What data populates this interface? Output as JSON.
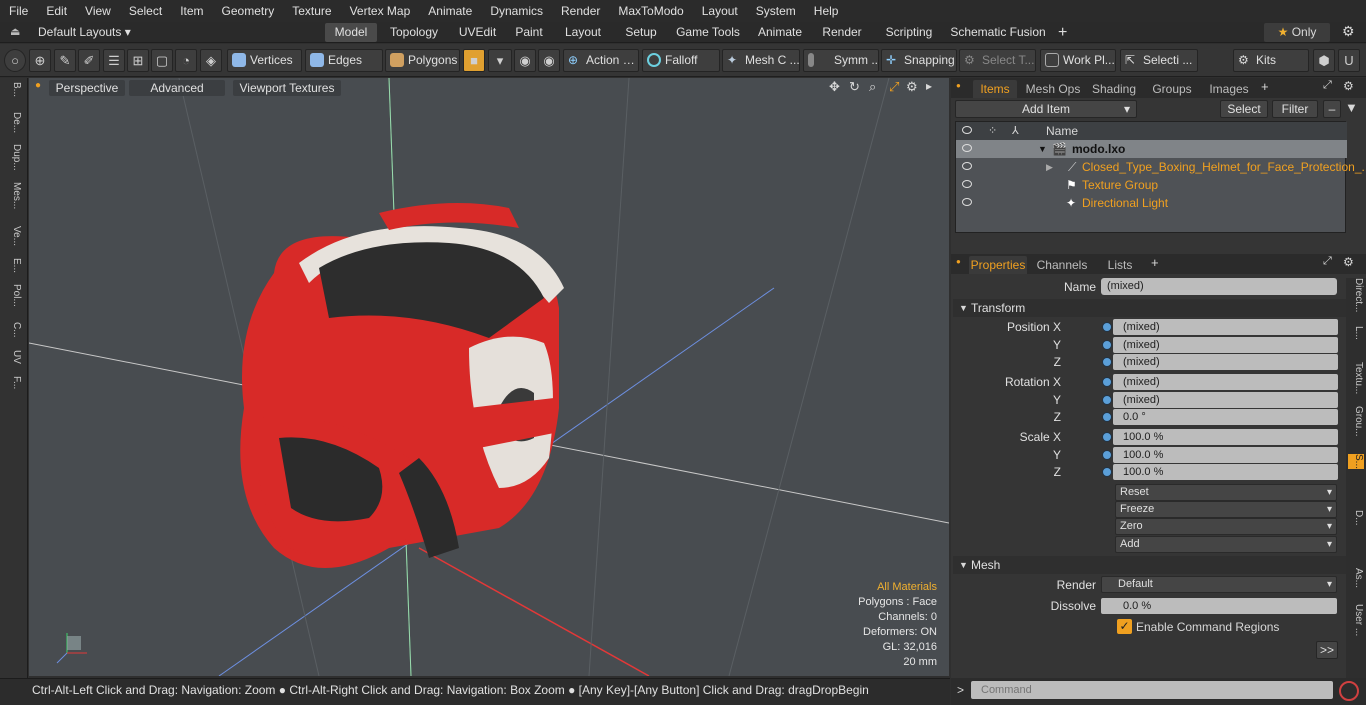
{
  "menu": [
    "File",
    "Edit",
    "View",
    "Select",
    "Item",
    "Geometry",
    "Texture",
    "Vertex Map",
    "Animate",
    "Dynamics",
    "Render",
    "MaxToModo",
    "Layout",
    "System",
    "Help"
  ],
  "layout_switcher": "Default Layouts",
  "mode_tabs": [
    "Model",
    "Topology",
    "UVEdit",
    "Paint",
    "Layout",
    "Setup",
    "Game Tools",
    "Animate",
    "Render",
    "Scripting",
    "Schematic Fusion"
  ],
  "only_label": "Only",
  "toolbar": {
    "vertices": "Vertices",
    "edges": "Edges",
    "polygons": "Polygons",
    "action": "Action",
    "falloff": "Falloff",
    "mesh_c": "Mesh C ...",
    "symm": "Symm ...",
    "snapping": "Snapping",
    "select_t": "Select T...",
    "work_pl": "Work Pl...",
    "selecti": "Selecti ...",
    "kits": "Kits"
  },
  "left_tools": [
    "B...",
    "De...",
    "Dup...",
    "Mes...",
    "Ve...",
    "E...",
    "Pol...",
    "C...",
    "UV",
    "F..."
  ],
  "viewport": {
    "perspective": "Perspective",
    "advanced": "Advanced",
    "viewport_textures": "Viewport Textures",
    "info": {
      "all_materials": "All Materials",
      "polygons": "Polygons : Face",
      "channels": "Channels: 0",
      "deformers": "Deformers: ON",
      "gl": "GL: 32,016",
      "scale": "20 mm"
    }
  },
  "status_text": "Ctrl-Alt-Left Click and Drag: Navigation: Zoom ● Ctrl-Alt-Right Click and Drag: Navigation: Box Zoom ● [Any Key]-[Any Button] Click and Drag: dragDropBegin",
  "items_panel": {
    "tabs": [
      "Items",
      "Mesh Ops",
      "Shading",
      "Groups",
      "Images"
    ],
    "add_item": "Add Item",
    "select": "Select",
    "filter": "Filter",
    "col_name": "Name",
    "rows": [
      "modo.lxo",
      "Closed_Type_Boxing_Helmet_for_Face_Protection_...",
      "Texture Group",
      "Directional Light"
    ]
  },
  "props_panel": {
    "tabs": [
      "Properties",
      "Channels",
      "Lists"
    ],
    "name_label": "Name",
    "name_value": "(mixed)",
    "transform": "Transform",
    "rows": [
      {
        "label": "Position X",
        "value": "(mixed)"
      },
      {
        "label": "Y",
        "value": "(mixed)"
      },
      {
        "label": "Z",
        "value": "(mixed)"
      },
      {
        "label": "Rotation X",
        "value": "(mixed)"
      },
      {
        "label": "Y",
        "value": "(mixed)"
      },
      {
        "label": "Z",
        "value": "0.0 °"
      },
      {
        "label": "Scale X",
        "value": "100.0 %"
      },
      {
        "label": "Y",
        "value": "100.0 %"
      },
      {
        "label": "Z",
        "value": "100.0 %"
      }
    ],
    "actions": [
      "Reset",
      "Freeze",
      "Zero",
      "Add"
    ],
    "mesh": "Mesh",
    "render_label": "Render",
    "render_value": "Default",
    "dissolve_label": "Dissolve",
    "dissolve_value": "0.0 %",
    "enable_cmd": "Enable Command Regions"
  },
  "right_side_tabs": [
    "Direct...",
    "L...",
    "Textu...",
    "Grou...",
    "S...",
    "D...",
    "As...",
    "User ..."
  ],
  "command_placeholder": "Command"
}
